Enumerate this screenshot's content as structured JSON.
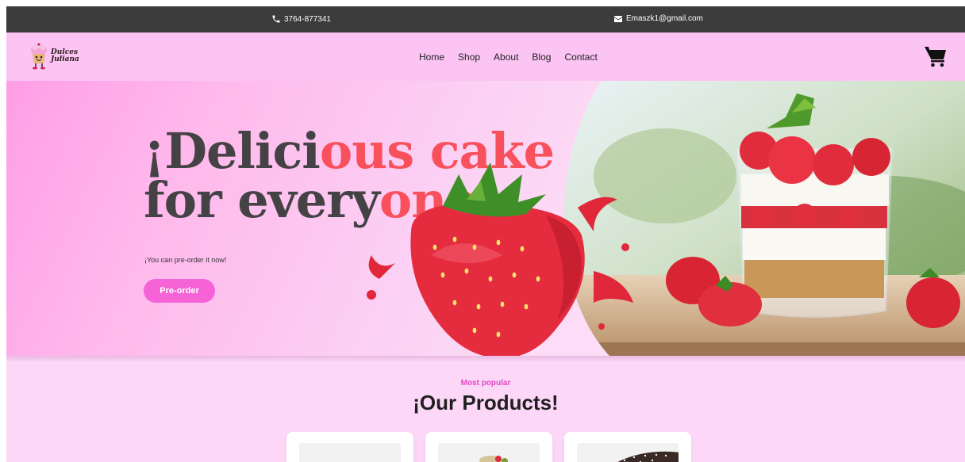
{
  "topbar": {
    "phone": "3764-877341",
    "email": "Emaszk1@gmail.com",
    "phone_icon": "phone-icon",
    "email_icon": "envelope-icon"
  },
  "brand": {
    "name_line1": "Dulces",
    "name_line2": "Juliana"
  },
  "nav": {
    "items": [
      "Home",
      "Shop",
      "About",
      "Blog",
      "Contact"
    ],
    "cart_icon": "shopping-cart-icon"
  },
  "hero": {
    "headline_line1_dark": "¡Delici",
    "headline_line1_accent": "ous cake",
    "headline_line2_dark": "for every",
    "headline_line2_accent": "one",
    "subtitle": "¡You can pre-order it now!",
    "cta_label": "Pre-order"
  },
  "products": {
    "eyebrow": "Most popular",
    "title": "¡Our Products!",
    "cards": [
      {
        "image": "product-photo-1"
      },
      {
        "image": "product-photo-2"
      },
      {
        "image": "product-photo-3"
      }
    ]
  },
  "colors": {
    "topbar_bg": "#3c3c3c",
    "nav_bg": "#fbc4f3",
    "page_bg": "#fcd7f7",
    "accent_red": "#f9505d",
    "button_pink": "#f563d6",
    "eyebrow_pink": "#e04ac4",
    "headline_dark": "#444244"
  }
}
